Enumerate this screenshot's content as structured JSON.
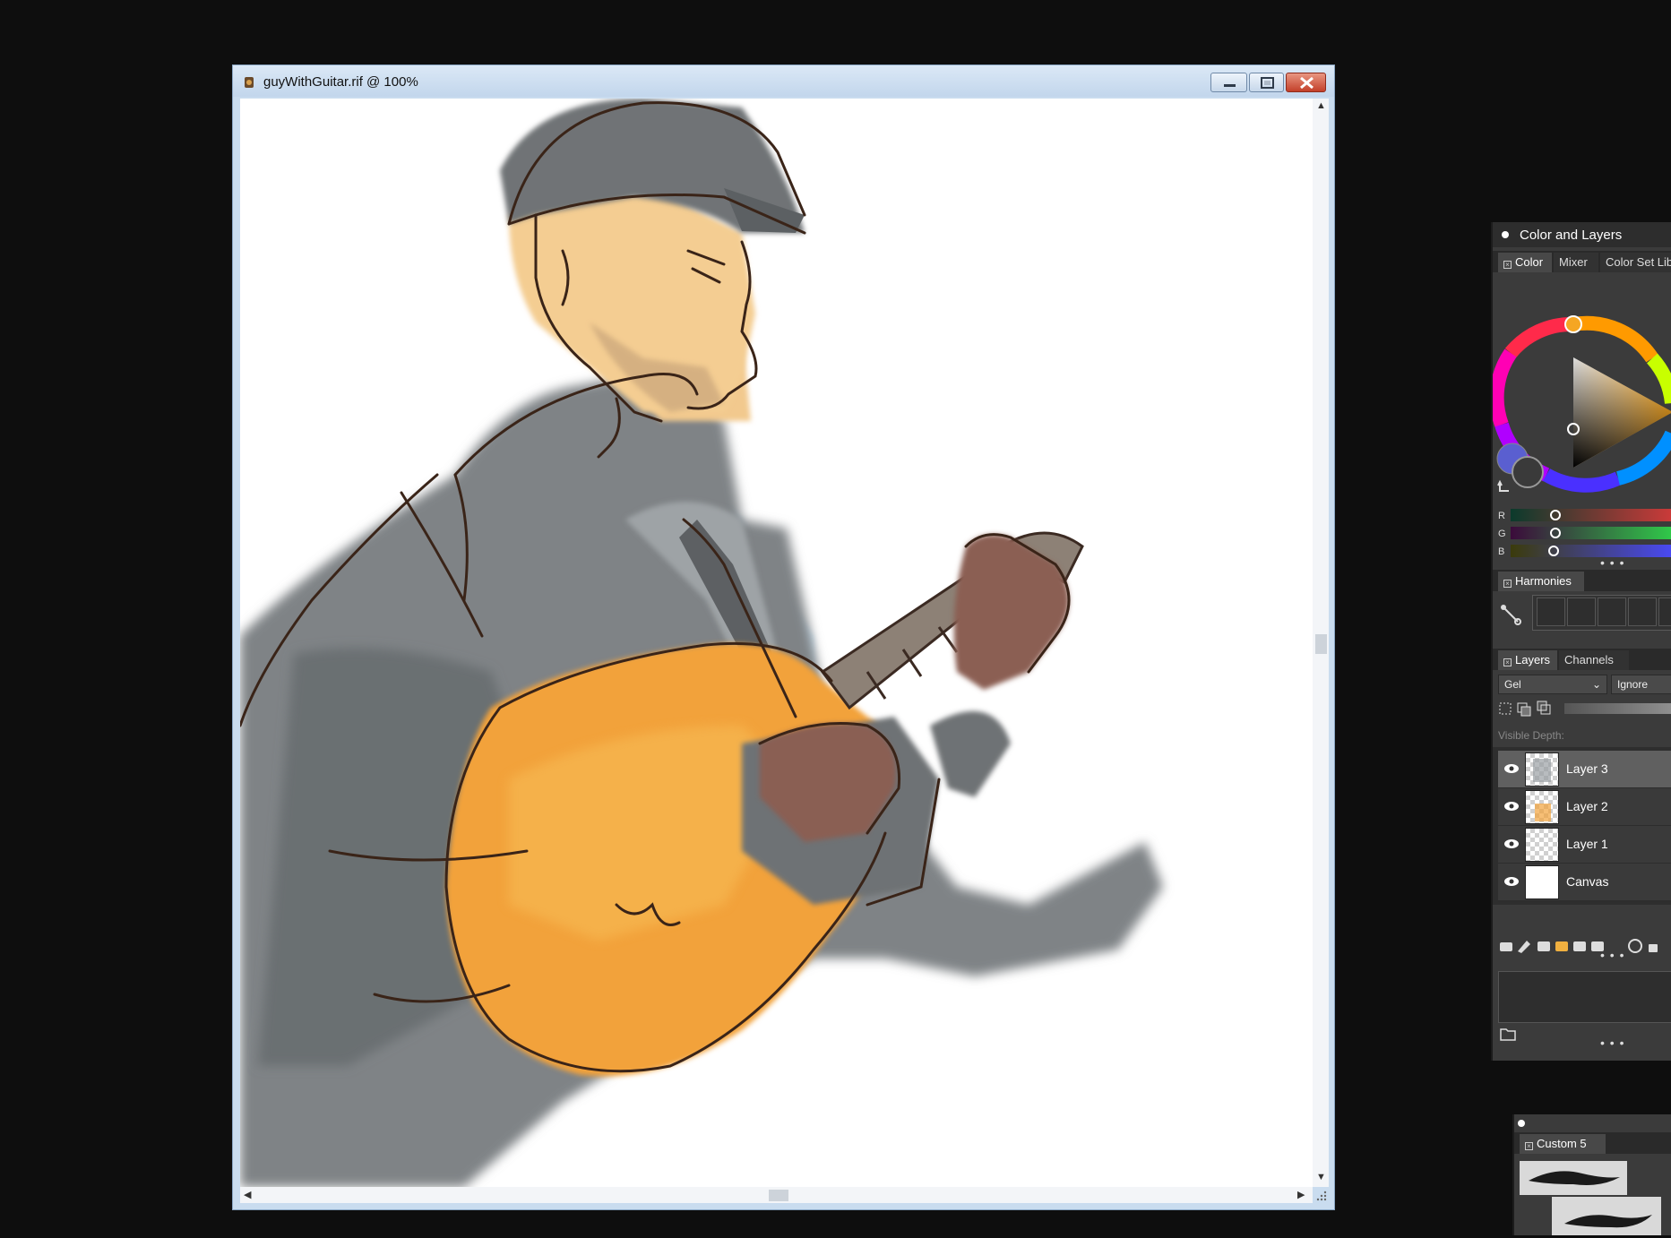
{
  "document": {
    "title": "guyWithGuitar.rif @ 100%",
    "controls": [
      "minimize-icon",
      "maximize-icon",
      "close-icon"
    ]
  },
  "color_panel": {
    "title": "Color and Layers",
    "tabs": [
      "Color",
      "Mixer",
      "Color Set Lib"
    ],
    "sliders": [
      {
        "label": "R"
      },
      {
        "label": "G"
      },
      {
        "label": "B"
      }
    ],
    "main_color": "#f5a623",
    "secondary_color": "#5a5fd0",
    "ring_marker_color": "#ffa500"
  },
  "harmonies": {
    "tab": "Harmonies"
  },
  "layers_panel": {
    "tabs": [
      "Layers",
      "Channels"
    ],
    "composite_method": "Gel",
    "composite_depth": "Ignore",
    "visible_depth_label": "Visible Depth:",
    "layers": [
      {
        "name": "Layer 3",
        "selected": true
      },
      {
        "name": "Layer 2",
        "selected": false
      },
      {
        "name": "Layer 1",
        "selected": false
      },
      {
        "name": "Canvas",
        "selected": false
      }
    ]
  },
  "brush_panel": {
    "tab": "Custom 5"
  }
}
